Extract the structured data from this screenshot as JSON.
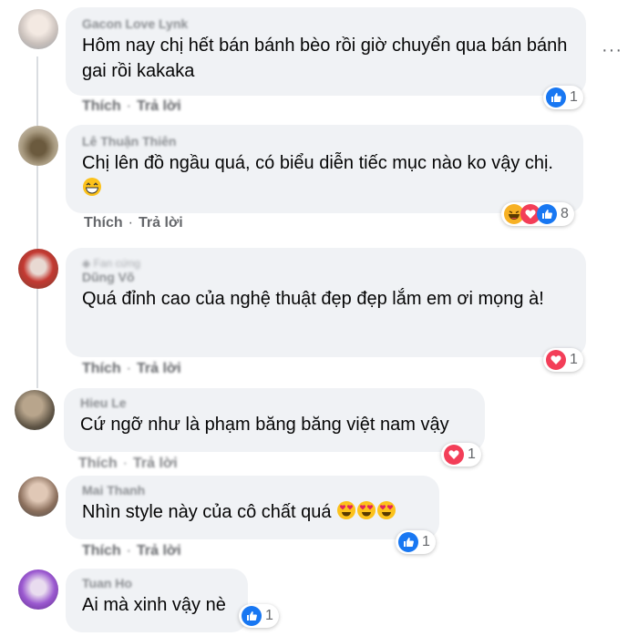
{
  "actions": {
    "like": "Thích",
    "reply": "Trả lời",
    "separator": "·"
  },
  "more_options": "···",
  "comments": [
    {
      "author": "Gacon Love Lynk",
      "text": "Hôm nay chị hết bán bánh bèo rồi giờ chuyển qua bán bánh gai rồi kakaka",
      "reactions": [
        "like"
      ],
      "count": "1"
    },
    {
      "author": "Lê Thuận Thiên",
      "text": "Chị lên đồ ngầu quá, có biểu diễn tiếc mục nào ko vậy chị.",
      "text_emoji": "grin",
      "reactions": [
        "haha",
        "love",
        "like"
      ],
      "count": "8"
    },
    {
      "fan_label": "Fan cứng",
      "author": "Dũng Võ",
      "text": "Quá đỉnh cao của nghệ thuật đẹp đẹp lắm em ơi mọng à!",
      "reactions": [
        "love"
      ],
      "count": "1"
    },
    {
      "author": "Hieu Le",
      "text": "Cứ ngỡ như là phạm băng băng việt nam vậy",
      "reactions": [
        "love"
      ],
      "count": "1"
    },
    {
      "author": "Mai Thanh",
      "text": "Nhìn style này của cô chất quá",
      "text_emoji": "heart-eyes x3",
      "reactions": [
        "like"
      ],
      "count": "1"
    },
    {
      "author": "Tuan Ho",
      "text": "Ai mà xinh vậy nè",
      "reactions": [
        "like"
      ],
      "count": "1"
    }
  ],
  "colors": {
    "like": "#1877f2",
    "love": "#f33e58",
    "haha": "#f7b125",
    "bubble": "#f0f2f5"
  }
}
